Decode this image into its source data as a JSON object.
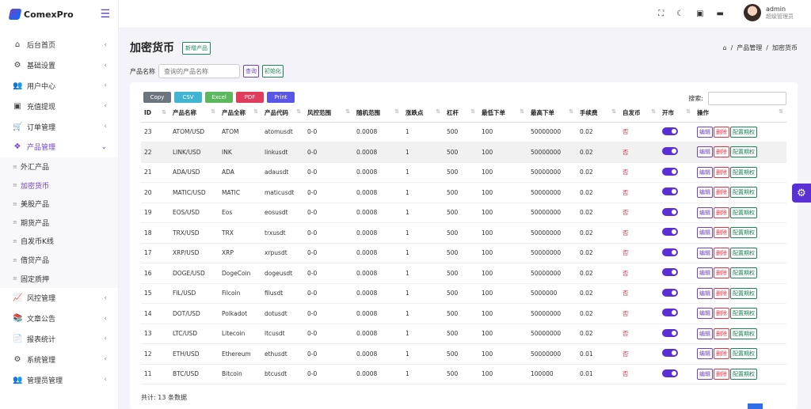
{
  "app": {
    "name": "ComexPro"
  },
  "sidebar": {
    "items": [
      {
        "icon": "home-icon",
        "glyph": "⌂",
        "label": "后台首页"
      },
      {
        "icon": "cogs-icon",
        "glyph": "⚙",
        "label": "基础设置"
      },
      {
        "icon": "users-icon",
        "glyph": "👥",
        "label": "用户中心"
      },
      {
        "icon": "money-icon",
        "glyph": "▣",
        "label": "充值提现"
      },
      {
        "icon": "cart-icon",
        "glyph": "🛒",
        "label": "订单管理"
      },
      {
        "icon": "cubes-icon",
        "glyph": "❖",
        "label": "产品管理",
        "active": true
      }
    ],
    "sub_items": [
      {
        "label": "外汇产品"
      },
      {
        "label": "加密货币",
        "active": true
      },
      {
        "label": "美股产品"
      },
      {
        "label": "期货产品"
      },
      {
        "label": "自发币K线"
      },
      {
        "label": "借贷产品"
      },
      {
        "label": "固定质押"
      }
    ],
    "items_after": [
      {
        "icon": "chart-line-icon",
        "glyph": "📈",
        "label": "风控管理"
      },
      {
        "icon": "book-icon",
        "glyph": "📚",
        "label": "文章公告"
      },
      {
        "icon": "file-icon",
        "glyph": "📄",
        "label": "报表统计"
      },
      {
        "icon": "gear-icon",
        "glyph": "⚙",
        "label": "系统管理"
      },
      {
        "icon": "user-group-icon",
        "glyph": "👥",
        "label": "管理员管理"
      }
    ]
  },
  "header": {
    "username": "admin",
    "role": "超级管理员"
  },
  "page": {
    "title": "加密货币",
    "add_button": "新增产品",
    "breadcrumb": [
      "产品管理",
      "加密货币"
    ]
  },
  "search": {
    "label": "产品名称",
    "placeholder": "查询的产品名称",
    "query_button": "查询",
    "reset_button": "初始化"
  },
  "export_buttons": [
    {
      "label": "Copy",
      "color": "#6c757d"
    },
    {
      "label": "CSV",
      "color": "#3fb5d1"
    },
    {
      "label": "Excel",
      "color": "#5cb85c"
    },
    {
      "label": "PDF",
      "color": "#e03c5c"
    },
    {
      "label": "Print",
      "color": "#5b57e6"
    }
  ],
  "table_search_label": "搜索:",
  "columns": [
    "ID",
    "产品名称",
    "产品全称",
    "产品代码",
    "风控范围",
    "随机范围",
    "涨跌点",
    "杠杆",
    "最低下单",
    "最高下单",
    "手续费",
    "自发币",
    "开市",
    "操作"
  ],
  "rows": [
    {
      "id": "23",
      "name": "ATOM/USD",
      "full": "ATOM",
      "code": "atomusdt",
      "risk": "0-0",
      "rand": "0.0008",
      "pt": "1",
      "lev": "500",
      "min": "100",
      "max": "50000000",
      "fee": "0.02",
      "self": "否"
    },
    {
      "id": "22",
      "name": "LINK/USD",
      "full": "INK",
      "code": "linkusdt",
      "risk": "0-0",
      "rand": "0.0008",
      "pt": "1",
      "lev": "500",
      "min": "100",
      "max": "50000000",
      "fee": "0.02",
      "self": "否"
    },
    {
      "id": "21",
      "name": "ADA/USD",
      "full": "ADA",
      "code": "adausdt",
      "risk": "0-0",
      "rand": "0.0008",
      "pt": "1",
      "lev": "500",
      "min": "100",
      "max": "50000000",
      "fee": "0.02",
      "self": "否"
    },
    {
      "id": "20",
      "name": "MATIC/USD",
      "full": "MATIC",
      "code": "maticusdt",
      "risk": "0-0",
      "rand": "0.0008",
      "pt": "1",
      "lev": "500",
      "min": "100",
      "max": "50000000",
      "fee": "0.02",
      "self": "否"
    },
    {
      "id": "19",
      "name": "EOS/USD",
      "full": "Eos",
      "code": "eosusdt",
      "risk": "0-0",
      "rand": "0.0008",
      "pt": "1",
      "lev": "500",
      "min": "100",
      "max": "50000000",
      "fee": "0.02",
      "self": "否"
    },
    {
      "id": "18",
      "name": "TRX/USD",
      "full": "TRX",
      "code": "trxusdt",
      "risk": "0-0",
      "rand": "0.0008",
      "pt": "1",
      "lev": "500",
      "min": "100",
      "max": "50000000",
      "fee": "0.02",
      "self": "否"
    },
    {
      "id": "17",
      "name": "XRP/USD",
      "full": "XRP",
      "code": "xrpusdt",
      "risk": "0-0",
      "rand": "0.0008",
      "pt": "1",
      "lev": "500",
      "min": "100",
      "max": "50000000",
      "fee": "0.02",
      "self": "否"
    },
    {
      "id": "16",
      "name": "DOGE/USD",
      "full": "DogeCoin",
      "code": "dogeusdt",
      "risk": "0-0",
      "rand": "0.0008",
      "pt": "1",
      "lev": "500",
      "min": "100",
      "max": "50000000",
      "fee": "0.02",
      "self": "否"
    },
    {
      "id": "15",
      "name": "FIL/USD",
      "full": "Filcoin",
      "code": "filusdt",
      "risk": "0-0",
      "rand": "0.0008",
      "pt": "1",
      "lev": "500",
      "min": "100",
      "max": "5000000",
      "fee": "0.02",
      "self": "否"
    },
    {
      "id": "14",
      "name": "DOT/USD",
      "full": "Polkadot",
      "code": "dotusdt",
      "risk": "0-0",
      "rand": "0.0008",
      "pt": "1",
      "lev": "500",
      "min": "100",
      "max": "50000000",
      "fee": "0.02",
      "self": "否"
    },
    {
      "id": "13",
      "name": "LTC/USD",
      "full": "Litecoin",
      "code": "ltcusdt",
      "risk": "0-0",
      "rand": "0.0008",
      "pt": "1",
      "lev": "500",
      "min": "100",
      "max": "50000000",
      "fee": "0.02",
      "self": "否"
    },
    {
      "id": "12",
      "name": "ETH/USD",
      "full": "Ethereum",
      "code": "ethusdt",
      "risk": "0-0",
      "rand": "0.0008",
      "pt": "1",
      "lev": "500",
      "min": "100",
      "max": "50000000",
      "fee": "0.01",
      "self": "否"
    },
    {
      "id": "11",
      "name": "BTC/USD",
      "full": "Bitcoin",
      "code": "btcusdt",
      "risk": "0-0",
      "rand": "0.0008",
      "pt": "1",
      "lev": "500",
      "min": "100",
      "max": "100000",
      "fee": "0.01",
      "self": "否"
    }
  ],
  "actions": {
    "edit": "编辑",
    "delete": "删除",
    "config": "配置期权"
  },
  "footer": {
    "total": "共计: 13 条数据"
  },
  "colors": {
    "accent": "#6f42c1",
    "toggle": "#5b2fd6",
    "danger": "#dc3545",
    "success": "#198754"
  }
}
